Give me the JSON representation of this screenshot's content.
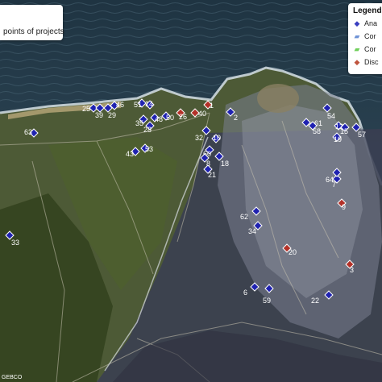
{
  "map": {
    "title_text": "points of projects",
    "attribution": "GEBCO",
    "colors": {
      "ocean": "#2f4756",
      "ocean_deep": "#263b48",
      "surf": "#c9d6de",
      "vegetation": "#5a6b3c",
      "urban_dark": "#3d4254",
      "urban_mid": "#6e7283",
      "built": "#8f949e",
      "analyzed": "#1f22b0",
      "discarded": "#b33128"
    }
  },
  "legend": {
    "title": "Legend",
    "items": [
      {
        "label": "Ana",
        "symbol": "◆",
        "color": "#3a3fc0"
      },
      {
        "label": "Cor",
        "symbol": "▰",
        "color": "#6f93d6"
      },
      {
        "label": "Cor",
        "symbol": "▰",
        "color": "#6fcf5a"
      },
      {
        "label": "Disc",
        "symbol": "◆",
        "color": "#c0553f"
      }
    ]
  },
  "markers": [
    {
      "label": "25",
      "type": "analyzed"
    },
    {
      "label": "39",
      "type": "analyzed"
    },
    {
      "label": "29",
      "type": "analyzed"
    },
    {
      "label": "46",
      "type": "analyzed"
    },
    {
      "label": "51",
      "type": "analyzed"
    },
    {
      "label": "14",
      "type": "analyzed"
    },
    {
      "label": "48",
      "type": "analyzed"
    },
    {
      "label": "50",
      "type": "analyzed"
    },
    {
      "label": "26",
      "type": "discarded"
    },
    {
      "label": "40",
      "type": "discarded"
    },
    {
      "label": "1",
      "type": "discarded"
    },
    {
      "label": "2",
      "type": "analyzed"
    },
    {
      "label": "35",
      "type": "analyzed"
    },
    {
      "label": "28",
      "type": "analyzed"
    },
    {
      "label": "63",
      "type": "analyzed"
    },
    {
      "label": "53",
      "type": "analyzed"
    },
    {
      "label": "43",
      "type": "analyzed"
    },
    {
      "label": "32",
      "type": "analyzed"
    },
    {
      "label": "10",
      "type": "analyzed"
    },
    {
      "label": "60",
      "type": "analyzed"
    },
    {
      "label": "8",
      "type": "analyzed"
    },
    {
      "label": "18",
      "type": "analyzed"
    },
    {
      "label": "21",
      "type": "analyzed"
    },
    {
      "label": "33",
      "type": "analyzed"
    },
    {
      "label": "62",
      "type": "analyzed"
    },
    {
      "label": "34",
      "type": "analyzed"
    },
    {
      "label": "20",
      "type": "discarded"
    },
    {
      "label": "3",
      "type": "discarded"
    },
    {
      "label": "6",
      "type": "analyzed"
    },
    {
      "label": "59",
      "type": "analyzed"
    },
    {
      "label": "22",
      "type": "analyzed"
    },
    {
      "label": "9",
      "type": "discarded"
    },
    {
      "label": "7",
      "type": "analyzed"
    },
    {
      "label": "64",
      "type": "analyzed"
    },
    {
      "label": "61",
      "type": "analyzed"
    },
    {
      "label": "54",
      "type": "analyzed"
    },
    {
      "label": "13",
      "type": "analyzed"
    },
    {
      "label": "15",
      "type": "analyzed"
    },
    {
      "label": "57",
      "type": "analyzed"
    },
    {
      "label": "19",
      "type": "analyzed"
    },
    {
      "label": "58",
      "type": "analyzed"
    }
  ]
}
